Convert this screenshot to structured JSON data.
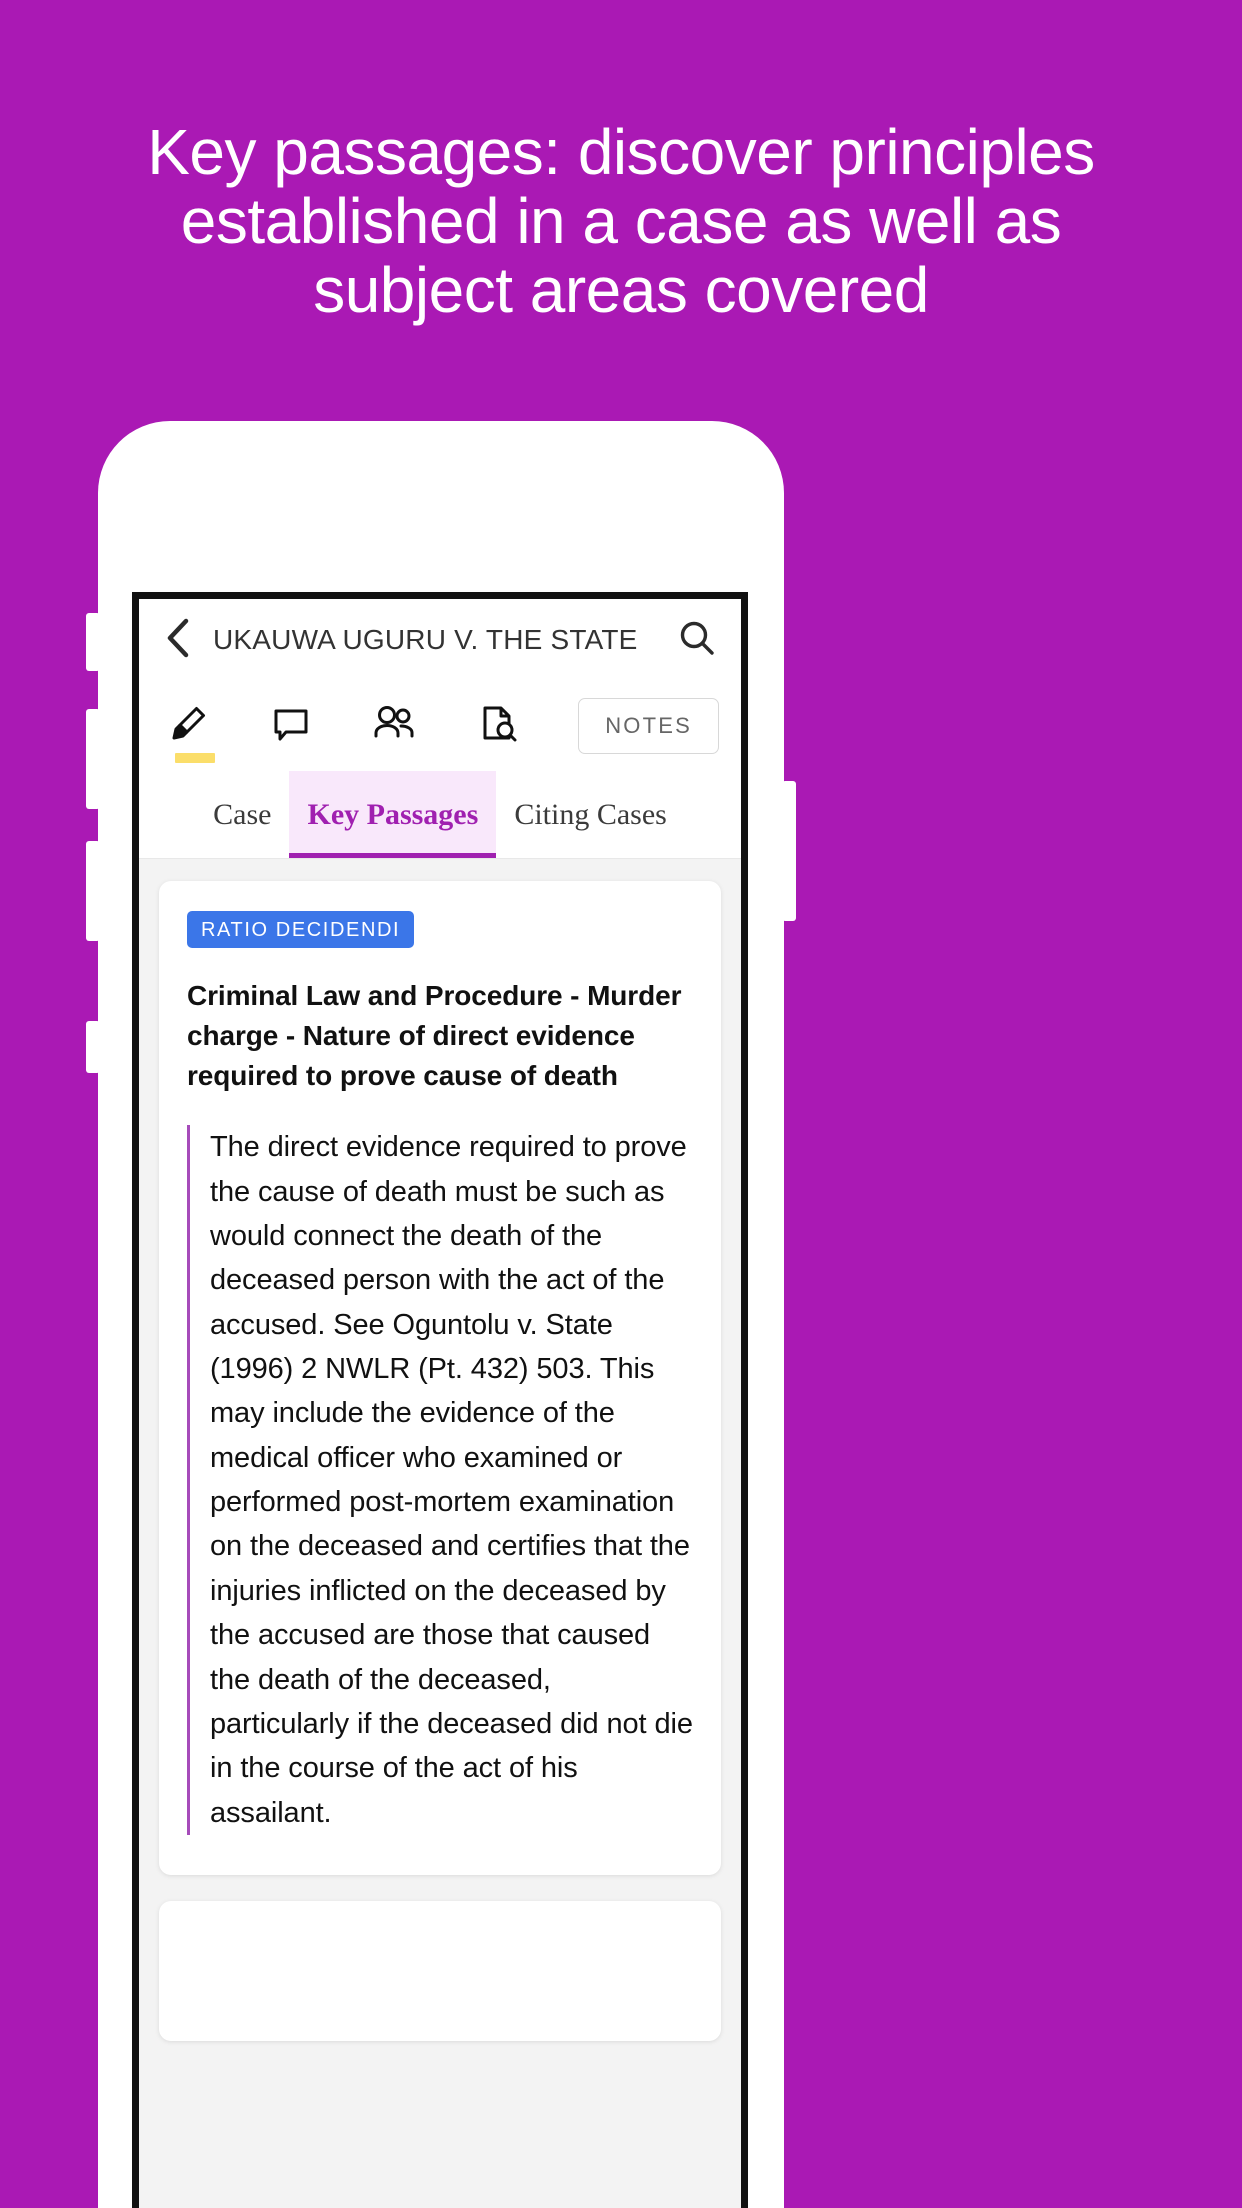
{
  "theme": {
    "background": "#AA19B4",
    "accent_purple": "#A020B0",
    "tab_active_bg": "#F9E8FB",
    "badge_blue": "#3B76E8",
    "highlighter_yellow": "#FBDE6A",
    "quote_rule": "#A64BBA"
  },
  "hero": {
    "lines": [
      "Key passages: discover principles",
      "established in a case as well as",
      "subject areas covered"
    ]
  },
  "app": {
    "appbar": {
      "back_icon": "chevron-left-icon",
      "title": "UKAUWA UGURU V. THE STATE",
      "search_icon": "search-icon"
    },
    "toolbar": {
      "icons": [
        {
          "name": "highlighter-icon",
          "active": true
        },
        {
          "name": "comment-icon",
          "active": false
        },
        {
          "name": "people-icon",
          "active": false
        },
        {
          "name": "document-search-icon",
          "active": false
        }
      ],
      "notes_label": "NOTES"
    },
    "tabs": [
      {
        "label": "Case",
        "active": false
      },
      {
        "label": "Key Passages",
        "active": true
      },
      {
        "label": "Citing Cases",
        "active": false
      }
    ],
    "cards": [
      {
        "badge": "RATIO DECIDENDI",
        "heading": "Criminal Law and Procedure - Murder charge - Nature of direct evidence required to prove cause of death",
        "quote": "The direct evidence required to prove the cause of death must be such as would connect the death of the deceased person with the act of the accused. See Oguntolu v. State (1996) 2 NWLR (Pt. 432) 503. This may include the evidence of the medical officer who examined or performed post-mortem examination on the deceased and certifies that the injuries inflicted on the deceased by the accused are those that caused the death of the deceased, particularly if the deceased did not die in the course of the act of his assailant."
      }
    ]
  }
}
